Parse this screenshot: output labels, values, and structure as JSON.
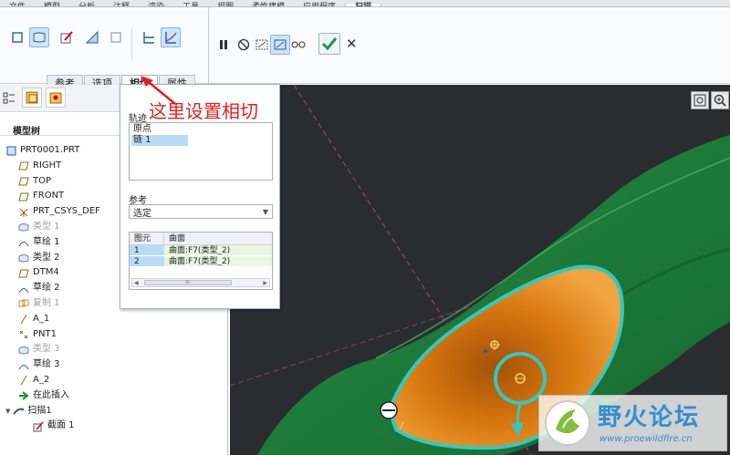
{
  "menu": [
    "文件",
    "模型",
    "分析",
    "注释",
    "渲染",
    "工具",
    "视图",
    "柔性建模",
    "应用程序",
    "扫描"
  ],
  "ribbon": {
    "tabs": [
      "参考",
      "选项",
      "相切",
      "属性"
    ],
    "active_tab": "相切"
  },
  "panel": {
    "trajectory_label": "轨迹",
    "trajectories": [
      "原点",
      "链 1"
    ],
    "reference_label": "参考",
    "reference_value": "选定",
    "table_headers": [
      "图元",
      "曲面"
    ],
    "table_rows": [
      [
        "1",
        "曲面:F7(类型_2)"
      ],
      [
        "2",
        "曲面:F7(类型_2)"
      ]
    ],
    "scroll_grip": "III"
  },
  "annotation": "这里设置相切",
  "tree": {
    "title": "模型树",
    "items": [
      {
        "label": "PRT0001.PRT",
        "icon": "part-icon",
        "indent": 0,
        "gray": false
      },
      {
        "label": "RIGHT",
        "icon": "datum-plane-icon",
        "indent": 1,
        "gray": false
      },
      {
        "label": "TOP",
        "icon": "datum-plane-icon",
        "indent": 1,
        "gray": false
      },
      {
        "label": "FRONT",
        "icon": "datum-plane-icon",
        "indent": 1,
        "gray": false
      },
      {
        "label": "PRT_CSYS_DEF",
        "icon": "csys-icon",
        "indent": 1,
        "gray": false
      },
      {
        "label": "类型 1",
        "icon": "surface-icon",
        "indent": 1,
        "gray": true
      },
      {
        "label": "草绘 1",
        "icon": "sketch-icon",
        "indent": 1,
        "gray": false
      },
      {
        "label": "类型 2",
        "icon": "surface-icon",
        "indent": 1,
        "gray": false
      },
      {
        "label": "DTM4",
        "icon": "datum-plane-icon",
        "indent": 1,
        "gray": false
      },
      {
        "label": "草绘 2",
        "icon": "sketch-icon",
        "indent": 1,
        "gray": false
      },
      {
        "label": "复制 1",
        "icon": "copy-icon",
        "indent": 1,
        "gray": true
      },
      {
        "label": "A_1",
        "icon": "axis-icon",
        "indent": 1,
        "gray": false
      },
      {
        "label": "PNT1",
        "icon": "point-icon",
        "indent": 1,
        "gray": false
      },
      {
        "label": "类型 3",
        "icon": "surface-icon",
        "indent": 1,
        "gray": true
      },
      {
        "label": "草绘 3",
        "icon": "sketch-icon",
        "indent": 1,
        "gray": false
      },
      {
        "label": "A_2",
        "icon": "axis-icon",
        "indent": 1,
        "gray": false
      },
      {
        "label": "在此插入",
        "icon": "insert-arrow-icon",
        "indent": 1,
        "gray": false
      },
      {
        "label": "扫描1",
        "icon": "sweep-icon",
        "indent": 0,
        "gray": false
      },
      {
        "label": "截面 1",
        "icon": "section-icon",
        "indent": 2,
        "gray": false
      }
    ]
  },
  "watermark": {
    "title": "野火论坛",
    "url": "www.proewildfire.cn"
  },
  "colors": {
    "accent": "#1f6fc5",
    "arrow": "#e02020",
    "confirm": "#1e9a3c",
    "surface_green": "#1e7b3a",
    "surface_orange": "#d9780f",
    "highlight_cyan": "#34c8c0"
  }
}
